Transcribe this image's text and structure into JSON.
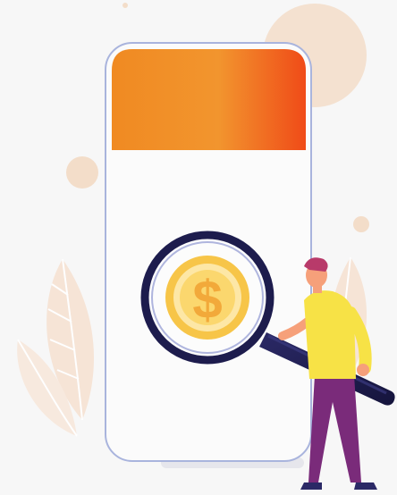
{
  "illustration": {
    "icon": "dollar-search-illustration",
    "coin_symbol": "$",
    "colors": {
      "background": "#f7f7f7",
      "phone_screen": "#fbfbfb",
      "phone_border": "#a9b4dd",
      "header_start": "#f08a22",
      "header_end": "#f04b18",
      "coin_fill": "#f7c548",
      "coin_inner": "#fde7a6",
      "magnifier_frame": "#1d1c4d",
      "person_shirt": "#f7e246",
      "person_pants": "#7a2b7a",
      "person_hair": "#b83a6a",
      "decor_peach": "#f1d8c4",
      "leaf_tint": "#f6e2d3"
    }
  }
}
